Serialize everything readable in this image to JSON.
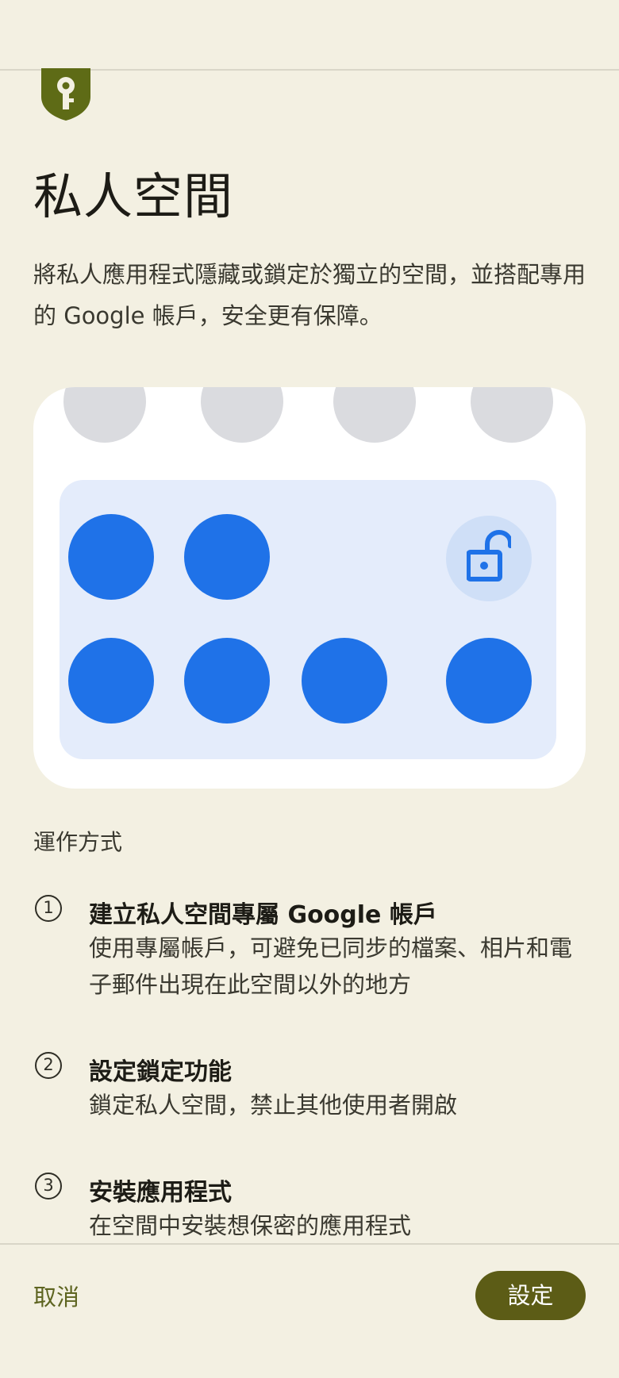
{
  "header": {
    "icon": "private-space-key-shield-icon",
    "title": "私人空間",
    "description": "將私人應用程式隱藏或鎖定於獨立的空間，並搭配專用的 Google 帳戶，安全更有保障。"
  },
  "illustration": {
    "lock_icon": "unlock-icon",
    "colors": {
      "app": "#1f72e8",
      "panel": "#e4ecfb",
      "grey_app": "#dadbdf"
    }
  },
  "how_it_works": {
    "label": "運作方式",
    "steps": [
      {
        "number": "1",
        "title": "建立私人空間專屬 Google 帳戶",
        "desc": "使用專屬帳戶，可避免已同步的檔案、相片和電子郵件出現在此空間以外的地方"
      },
      {
        "number": "2",
        "title": "設定鎖定功能",
        "desc": "鎖定私人空間，禁止其他使用者開啟"
      },
      {
        "number": "3",
        "title": "安裝應用程式",
        "desc": "在空間中安裝想保密的應用程式"
      }
    ]
  },
  "footer": {
    "cancel_label": "取消",
    "setup_label": "設定",
    "accent_color": "#5c5c16"
  }
}
